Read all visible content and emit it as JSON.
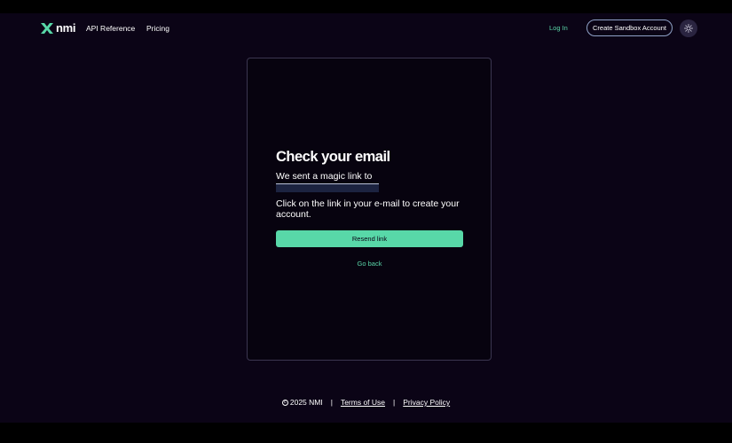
{
  "header": {
    "logo_text": "nmi",
    "nav": [
      {
        "label": "API Reference"
      },
      {
        "label": "Pricing"
      }
    ],
    "login_label": "Log In",
    "sandbox_label": "Create Sandbox Account",
    "theme_icon": "sun-icon"
  },
  "card": {
    "title": "Check your email",
    "sent_text": "We sent a magic link to",
    "instructions": "Click on the link in your e-mail to create your account.",
    "resend_label": "Resend link",
    "go_back_label": "Go back"
  },
  "footer": {
    "copyright": "2025 NMI",
    "separator": "|",
    "terms_label": "Terms of Use",
    "privacy_label": "Privacy Policy"
  },
  "colors": {
    "background": "#0b0416",
    "accent": "#58d8a8",
    "link": "#5ad6a9"
  }
}
